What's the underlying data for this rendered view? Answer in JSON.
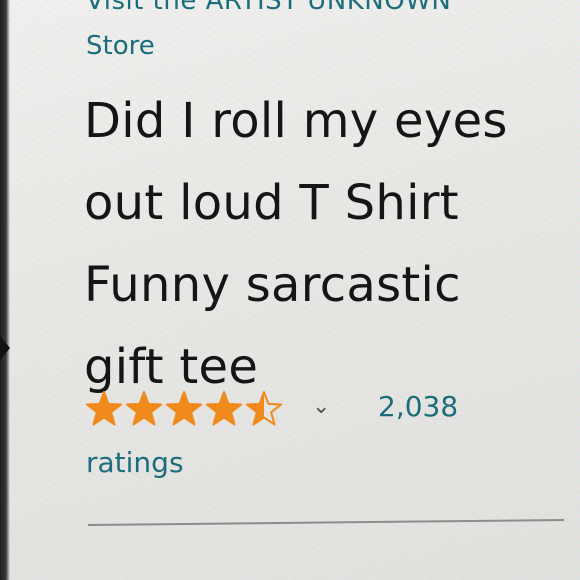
{
  "store": {
    "line1": "Visit the ARTIST UNKNOWN",
    "line2": "Store"
  },
  "product": {
    "title_lines": [
      "Did I roll my eyes",
      "out loud T Shirt",
      "Funny sarcastic",
      "gift tee"
    ]
  },
  "rating": {
    "stars": 4.5,
    "stars_max": 5,
    "count": "2,038",
    "count_word": "ratings",
    "star_color": "#f08a1c",
    "link_color": "#1c6d7b"
  },
  "icons": {
    "rating_dropdown": "chevron-down-icon",
    "carousel_prev": "left-arrow-icon"
  }
}
